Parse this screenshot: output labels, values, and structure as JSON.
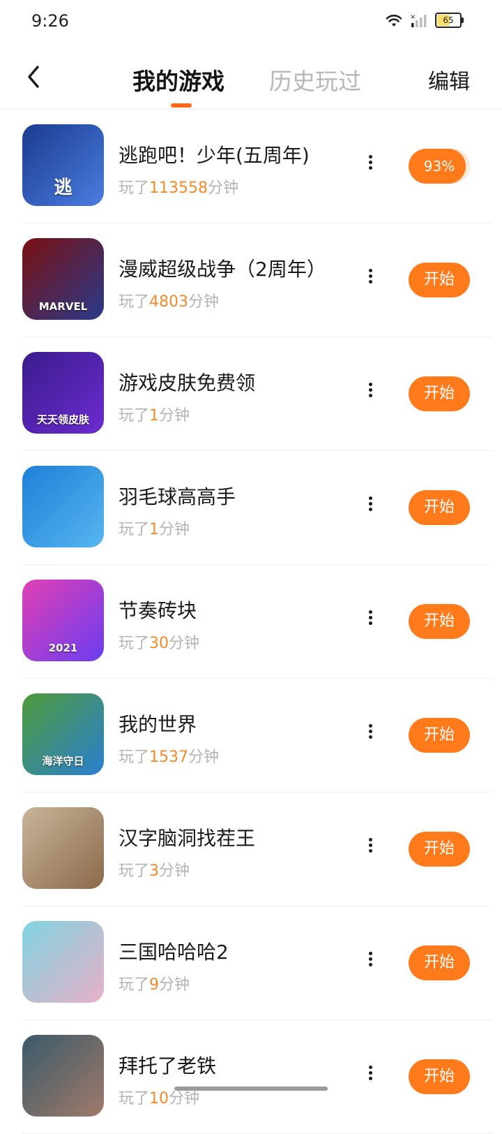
{
  "status": {
    "time": "9:26",
    "battery": "65",
    "battery_level": 0.65
  },
  "nav": {
    "tabs": [
      {
        "label": "我的游戏",
        "active": true
      },
      {
        "label": "历史玩过",
        "active": false
      }
    ],
    "edit_label": "编辑"
  },
  "colors": {
    "accent": "#ff7a1a",
    "minutes": "#f08a2a",
    "muted": "#b3b3b3"
  },
  "play_prefix": "玩了",
  "play_suffix": "分钟",
  "start_label": "开始",
  "games": [
    {
      "title": "逃跑吧！少年(五周年)",
      "minutes": "113558",
      "action": "progress",
      "progress_label": "93%",
      "progress": 0.93,
      "icon_badge": "逃",
      "icon_colors": [
        "#1b3b8f",
        "#4a7de0"
      ]
    },
    {
      "title": "漫威超级战争（2周年）",
      "minutes": "4803",
      "action": "start",
      "icon_badge": "MARVEL",
      "icon_colors": [
        "#7a1010",
        "#2a3a8c"
      ]
    },
    {
      "title": "游戏皮肤免费领",
      "minutes": "1",
      "action": "start",
      "icon_badge": "天天领皮肤",
      "icon_colors": [
        "#3a1c8c",
        "#6b2bd1"
      ]
    },
    {
      "title": "羽毛球高高手",
      "minutes": "1",
      "action": "start",
      "icon_badge": "",
      "icon_colors": [
        "#1e7fd8",
        "#57b6f0"
      ]
    },
    {
      "title": "节奏砖块",
      "minutes": "30",
      "action": "start",
      "icon_badge": "2021",
      "icon_colors": [
        "#e23fb5",
        "#6a3df0"
      ]
    },
    {
      "title": "我的世界",
      "minutes": "1537",
      "action": "start",
      "icon_badge": "海洋守日",
      "icon_colors": [
        "#4f9b3a",
        "#2a7fd0"
      ]
    },
    {
      "title": "汉字脑洞找茬王",
      "minutes": "3",
      "action": "start",
      "icon_badge": "",
      "icon_colors": [
        "#c9b49a",
        "#8a6a4a"
      ]
    },
    {
      "title": "三国哈哈哈2",
      "minutes": "9",
      "action": "start",
      "icon_badge": "",
      "icon_colors": [
        "#7fd3e0",
        "#e8b0c8"
      ]
    },
    {
      "title": "拜托了老铁",
      "minutes": "10",
      "action": "start",
      "icon_badge": "",
      "icon_colors": [
        "#3a5a6a",
        "#a07a6a"
      ]
    }
  ]
}
